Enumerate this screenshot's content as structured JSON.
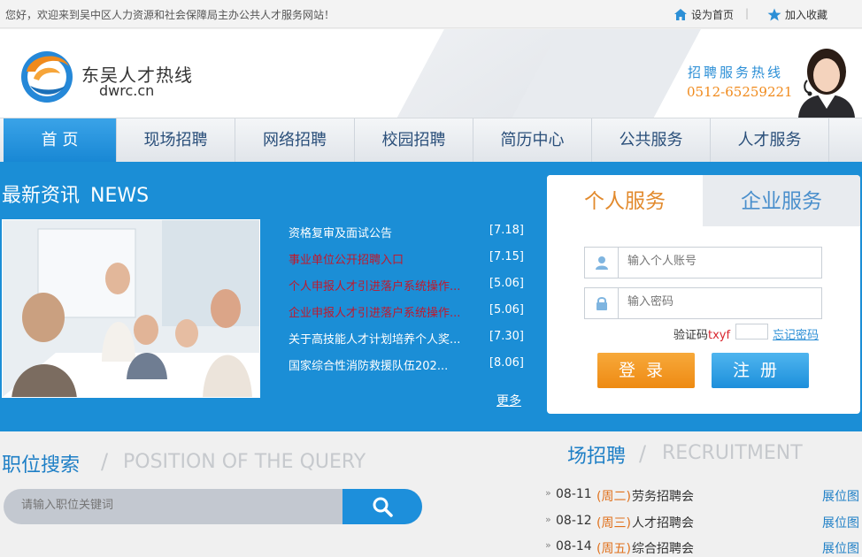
{
  "topbar": {
    "welcome": "您好，欢迎来到吴中区人力资源和社会保障局主办公共人才服务网站！",
    "set_home": "设为首页",
    "favorite": "加入收藏",
    "separator": "|"
  },
  "header": {
    "logo_name": "东吴人才热线",
    "logo_domain": "dwrc.cn",
    "hotline_label": "招聘服务热线",
    "hotline_number": "0512-65259221"
  },
  "nav": {
    "items": [
      "首  页",
      "现场招聘",
      "网络招聘",
      "校园招聘",
      "简历中心",
      "公共服务",
      "人才服务"
    ]
  },
  "news": {
    "title_cn": "最新资讯",
    "title_en": "NEWS",
    "more": "更多",
    "items": [
      {
        "title": "资格复审及面试公告",
        "date": "[7.18]",
        "color": "#ffffff"
      },
      {
        "title": "事业单位公开招聘入口",
        "date": "[7.15]",
        "color": "#c0182c"
      },
      {
        "title": "个人申报人才引进落户系统操作...",
        "date": "[5.06]",
        "color": "#c0182c"
      },
      {
        "title": "企业申报人才引进落户系统操作...",
        "date": "[5.06]",
        "color": "#c0182c"
      },
      {
        "title": "关于高技能人才计划培养个人奖...",
        "date": "[7.30]",
        "color": "#ffffff"
      },
      {
        "title": "国家综合性消防救援队伍202...",
        "date": "[8.06]",
        "color": "#ffffff"
      }
    ]
  },
  "login": {
    "tab_personal": "个人服务",
    "tab_enterprise": "企业服务",
    "account_placeholder": "输入个人账号",
    "password_placeholder": "输入密码",
    "captcha_label": "验证码",
    "captcha_code": "txyf",
    "forgot": "忘记密码",
    "login_btn": "登录",
    "register_btn": "注册"
  },
  "position_search": {
    "title_cn": "职位搜索",
    "title_en": "POSITION OF THE QUERY",
    "placeholder": "请输入职位关键词"
  },
  "recruitment": {
    "title_cn": "场招聘",
    "title_en": "RECRUITMENT",
    "items": [
      {
        "bullet": "»",
        "date": "08-11",
        "weekday": "(周二)",
        "name": "劳务招聘会",
        "map": "展位图"
      },
      {
        "bullet": "»",
        "date": "08-12",
        "weekday": "(周三)",
        "name": "人才招聘会",
        "map": "展位图"
      },
      {
        "bullet": "»",
        "date": "08-14",
        "weekday": "(周五)",
        "name": "综合招聘会",
        "map": "展位图"
      }
    ]
  },
  "colors": {
    "primary_blue": "#1b8ed6",
    "orange": "#ee8a12",
    "nav_text": "#2a4f7a"
  }
}
